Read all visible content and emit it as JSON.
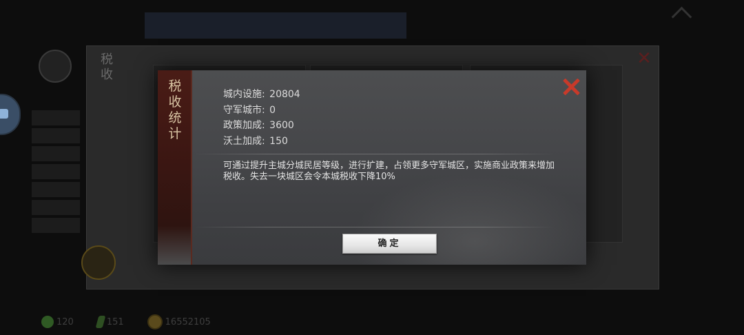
{
  "dialog": {
    "title_chars": [
      "税",
      "收",
      "统",
      "计"
    ],
    "stats": [
      {
        "label": "城内设施:",
        "value": "20804"
      },
      {
        "label": "守军城市:",
        "value": "0"
      },
      {
        "label": "政策加成:",
        "value": "3600"
      },
      {
        "label": "沃土加成:",
        "value": "150"
      }
    ],
    "description": "可通过提升主城分城民居等级，进行扩建，占领更多守军城区，实施商业政策来增加税收。失去一块城区会令本城税收下降10%",
    "confirm_label": "确定",
    "close_icon": "close-icon",
    "close_color": "#c83a2a"
  },
  "background": {
    "panel_title": "税收",
    "resources": [
      {
        "icon": "jade-icon",
        "value": "120"
      },
      {
        "icon": "leaf-icon",
        "value": "151"
      },
      {
        "icon": "gold-coin-icon",
        "value": "16552105"
      }
    ]
  }
}
